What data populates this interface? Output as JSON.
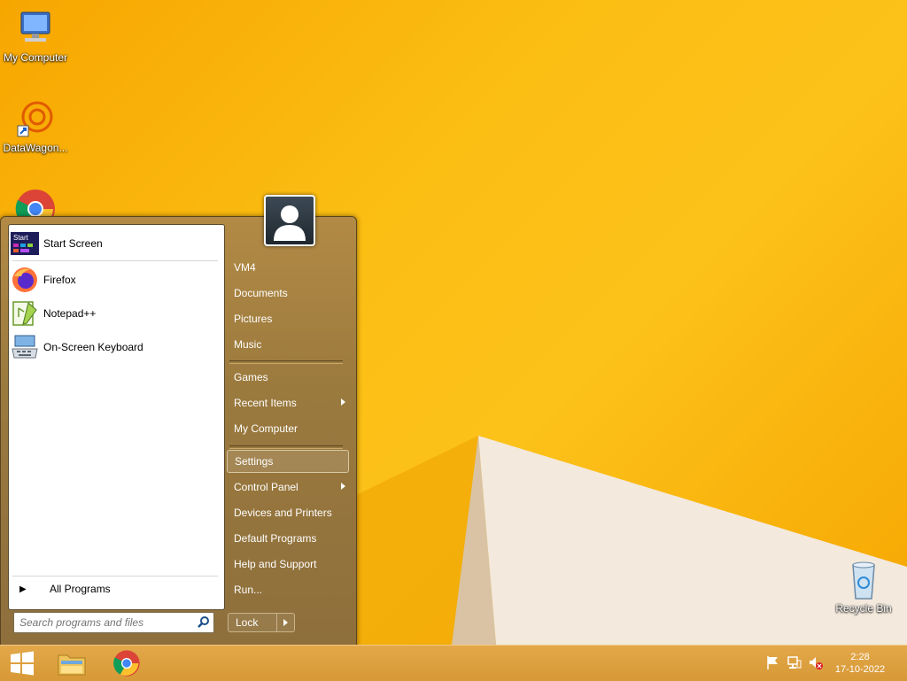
{
  "desktop": {
    "icons": [
      {
        "label": "My Computer"
      },
      {
        "label": "DataWagon..."
      },
      {
        "label": "Recycle Bin"
      }
    ]
  },
  "start_menu": {
    "pinned": [
      {
        "label": "Start Screen",
        "icon": "start-screen-icon"
      },
      {
        "label": "Firefox",
        "icon": "firefox-icon"
      },
      {
        "label": "Notepad++",
        "icon": "notepad-plus-plus-icon"
      },
      {
        "label": "On-Screen Keyboard",
        "icon": "keyboard-icon"
      }
    ],
    "start_screen_tile_text": "Start",
    "all_programs": "All Programs",
    "search_placeholder": "Search programs and files",
    "right_items": [
      {
        "label": "VM4"
      },
      {
        "label": "Documents"
      },
      {
        "label": "Pictures"
      },
      {
        "label": "Music"
      },
      {
        "label": "Games"
      },
      {
        "label": "Recent Items"
      },
      {
        "label": "My Computer"
      },
      {
        "label": "Settings"
      },
      {
        "label": "Control Panel"
      },
      {
        "label": "Devices and Printers"
      },
      {
        "label": "Default Programs"
      },
      {
        "label": "Help and Support"
      },
      {
        "label": "Run..."
      }
    ],
    "lock_label": "Lock"
  },
  "taskbar": {
    "clock_time": "2:28",
    "clock_date": "17-10-2022"
  }
}
